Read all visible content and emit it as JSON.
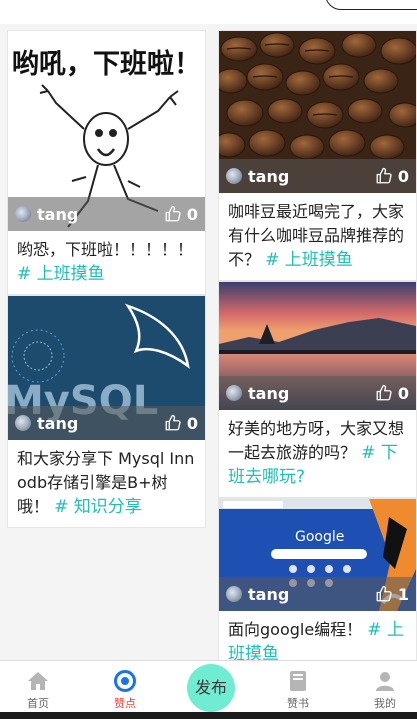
{
  "posts_left": [
    {
      "author": "tang",
      "likes": "0",
      "text": "哟恐，下班啦！！！！！",
      "tag": "# 上班摸鱼",
      "image": "meme-rage-comic",
      "image_caption": "哟吼，下班啦！"
    },
    {
      "author": "tang",
      "likes": "0",
      "text": "和大家分享下 Mysql Innodb存储引擎是B+树哦！",
      "tag": "# 知识分享",
      "image": "mysql-dolphin-logo"
    }
  ],
  "posts_right": [
    {
      "author": "tang",
      "likes": "0",
      "text": "咖啡豆最近喝完了，大家有什么咖啡豆品牌推荐的不？",
      "tag": "# 上班摸鱼",
      "image": "coffee-beans"
    },
    {
      "author": "tang",
      "likes": "0",
      "text": "好美的地方呀，大家又想一起去旅游的吗？",
      "tag": "# 下班去哪玩?",
      "image": "lake-sunset"
    },
    {
      "author": "tang",
      "likes": "1",
      "text": "面向google编程！",
      "tag": "# 上班摸鱼",
      "image": "google-chrome-screen",
      "image_caption": "Google"
    }
  ],
  "tabbar": {
    "items": [
      {
        "label": "首页",
        "icon": "home-icon",
        "active": false
      },
      {
        "label": "赞点",
        "icon": "target-icon",
        "active": true
      },
      {
        "label": "赞书",
        "icon": "book-icon",
        "active": false
      },
      {
        "label": "我的",
        "icon": "user-icon",
        "active": false
      }
    ],
    "publish_label": "发布"
  },
  "colors": {
    "accent": "#1ec0b3",
    "active_tab": "#e0453a",
    "publish_bg": "#70ecd2"
  }
}
